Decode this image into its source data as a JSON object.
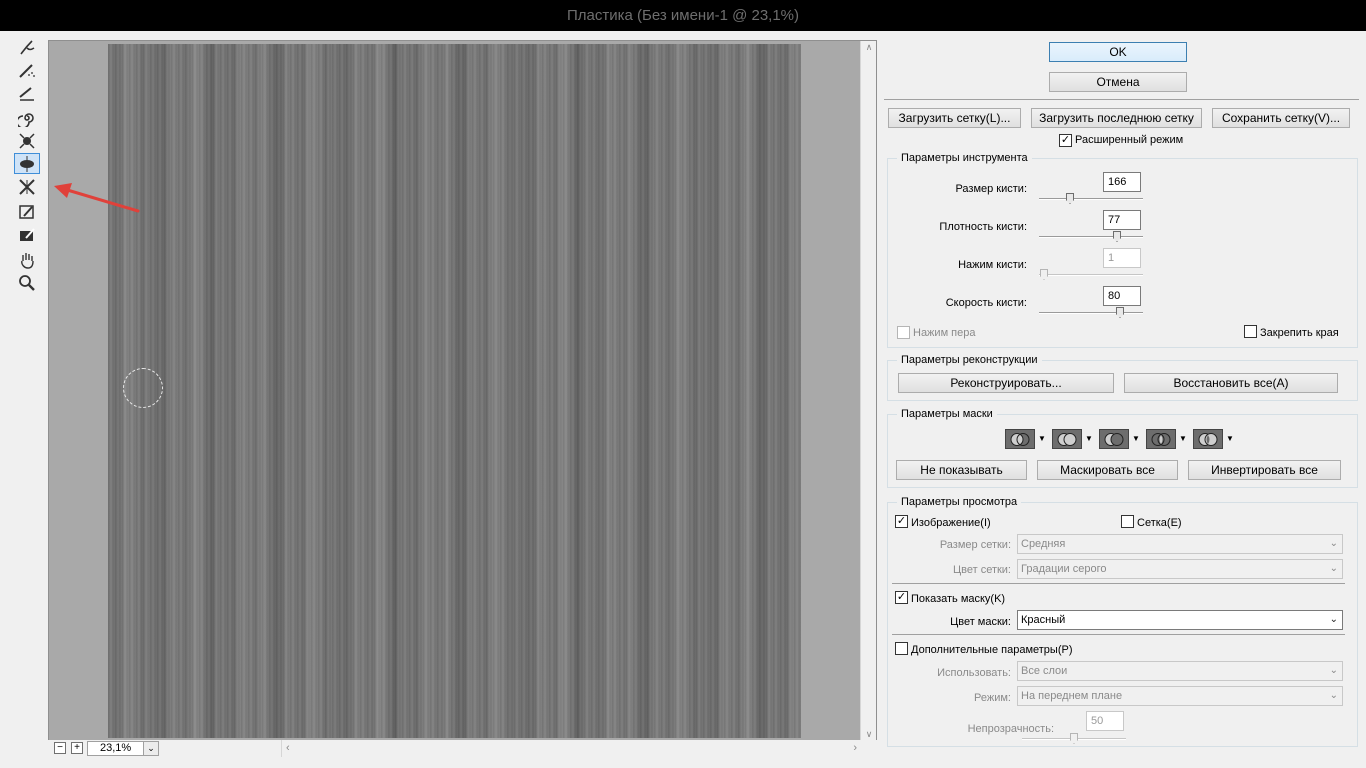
{
  "window": {
    "title": "Пластика (Без имени-1 @ 23,1%)"
  },
  "tools": [
    {
      "name": "forward-warp-tool",
      "active": false
    },
    {
      "name": "reconstruct-tool",
      "active": false
    },
    {
      "name": "smooth-tool",
      "active": false
    },
    {
      "name": "twirl-tool",
      "active": false
    },
    {
      "name": "pucker-tool",
      "active": false
    },
    {
      "name": "bloat-tool",
      "active": true
    },
    {
      "name": "push-left-tool",
      "active": false
    },
    {
      "name": "freeze-mask-tool",
      "active": false
    },
    {
      "name": "thaw-mask-tool",
      "active": false
    },
    {
      "name": "hand-tool",
      "active": false
    },
    {
      "name": "zoom-tool",
      "active": false
    }
  ],
  "canvas": {
    "zoom_value": "23,1%"
  },
  "zoom_controls": {
    "minus": "−",
    "plus": "+",
    "dropdown": "⌄"
  },
  "dialog": {
    "ok": "OK",
    "cancel": "Отмена",
    "load_mesh": "Загрузить сетку(L)...",
    "load_last_mesh": "Загрузить последнюю сетку",
    "save_mesh": "Сохранить сетку(V)...",
    "advanced_mode": {
      "label": "Расширенный режим",
      "checked": true
    }
  },
  "tool_options": {
    "title": "Параметры инструмента",
    "brush_size": {
      "label": "Размер кисти:",
      "value": "166",
      "level": 0.28
    },
    "brush_density": {
      "label": "Плотность кисти:",
      "value": "77",
      "level": 0.77
    },
    "brush_pressure": {
      "label": "Нажим кисти:",
      "value": "1",
      "level": 0.01
    },
    "brush_rate": {
      "label": "Скорость кисти:",
      "value": "80",
      "level": 0.8
    },
    "stylus_pressure": {
      "label": "Нажим пера",
      "checked": false
    },
    "pin_edges": {
      "label": "Закрепить края",
      "checked": false
    }
  },
  "reconstruct_options": {
    "title": "Параметры реконструкции",
    "reconstruct": "Реконструировать...",
    "restore_all": "Восстановить все(A)"
  },
  "mask_options": {
    "title": "Параметры маски",
    "modes": [
      "replace-selection-icon",
      "add-to-selection-icon",
      "subtract-from-selection-icon",
      "intersect-selection-icon",
      "invert-selection-icon"
    ],
    "none": "Не показывать",
    "mask_all": "Маскировать все",
    "invert_all": "Инвертировать все"
  },
  "view_options": {
    "title": "Параметры просмотра",
    "show_image": {
      "label": "Изображение(I)",
      "checked": true
    },
    "show_mesh": {
      "label": "Сетка(E)",
      "checked": false
    },
    "mesh_size": {
      "label": "Размер сетки:",
      "value": "Средняя"
    },
    "mesh_color": {
      "label": "Цвет сетки:",
      "value": "Градации серого"
    },
    "show_mask": {
      "label": "Показать маску(K)",
      "checked": true
    },
    "mask_color": {
      "label": "Цвет маски:",
      "value": "Красный"
    },
    "show_backdrop": {
      "label": "Дополнительные параметры(P)",
      "checked": false
    },
    "use": {
      "label": "Использовать:",
      "value": "Все слои"
    },
    "mode": {
      "label": "Режим:",
      "value": "На переднем плане"
    },
    "opacity": {
      "label": "Непрозрачность:",
      "value": "50",
      "level": 0.5
    }
  },
  "colors": {
    "accent": "#3f8ed8",
    "annotation_arrow": "#e0413a",
    "title_bar": "#000000"
  }
}
